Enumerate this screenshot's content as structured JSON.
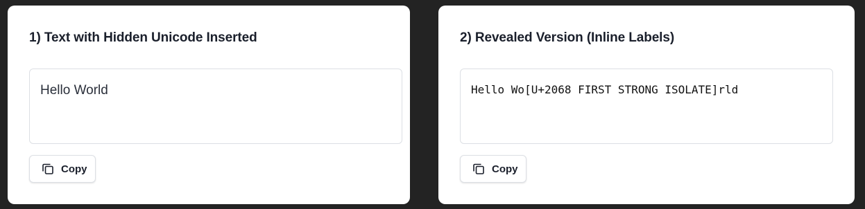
{
  "panels": [
    {
      "title": "1) Text with Hidden Unicode Inserted",
      "text": "Hello World",
      "copy_label": "Copy",
      "copy_icon": "copy-icon"
    },
    {
      "title": "2) Revealed Version (Inline Labels)",
      "text": "Hello Wo[U+2068 FIRST STRONG ISOLATE]rld",
      "copy_label": "Copy",
      "copy_icon": "copy-icon"
    }
  ],
  "colors": {
    "background": "#232323",
    "panel": "#ffffff",
    "border": "#dcdfe4",
    "text": "#1a1f2b"
  }
}
